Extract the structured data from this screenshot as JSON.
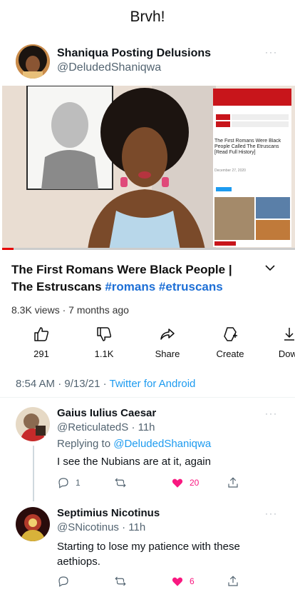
{
  "caption": "Brvh!",
  "post": {
    "display_name": "Shaniqua Posting Delusions",
    "handle": "@DeludedShaniqwa",
    "more": "···"
  },
  "video": {
    "progress": 0.04,
    "overlay_headline": "The First Romans Were Black People Called The Etruscans [Read Full History]",
    "overlay_date": "December 27, 2020",
    "title_main": "The First Romans Were Black People | The Estruscans",
    "title_tags": "#romans #etruscans",
    "meta": "8.3K views · 7 months ago"
  },
  "actions": [
    {
      "icon": "thumbs-up-icon",
      "label": "291"
    },
    {
      "icon": "thumbs-down-icon",
      "label": "1.1K"
    },
    {
      "icon": "share-icon",
      "label": "Share"
    },
    {
      "icon": "create-icon",
      "label": "Create"
    },
    {
      "icon": "download-icon",
      "label": "Dowr"
    }
  ],
  "tweet_meta": {
    "time_date": "8:54 AM · 9/13/21 · ",
    "client": "Twitter for Android"
  },
  "replies": [
    {
      "display_name": "Gaius Iulius Caesar",
      "handle": "@ReticulatedS · 11h",
      "replying_prefix": "Replying to ",
      "replying_to": "@DeludedShaniqwa",
      "text": "I see the Nubians are at it, again",
      "reply_count": "1",
      "retweet_count": "",
      "like_count": "20",
      "more": "···"
    },
    {
      "display_name": "Septimius Nicotinus",
      "handle": "@SNicotinus · 11h",
      "text": "Starting to lose my patience with these aethiops.",
      "reply_count": "",
      "retweet_count": "",
      "like_count": "6",
      "more": "···"
    }
  ],
  "colors": {
    "accent": "#1d9bf0",
    "like": "#f91880",
    "progress": "#e60000",
    "tag": "#1d6fd6"
  }
}
